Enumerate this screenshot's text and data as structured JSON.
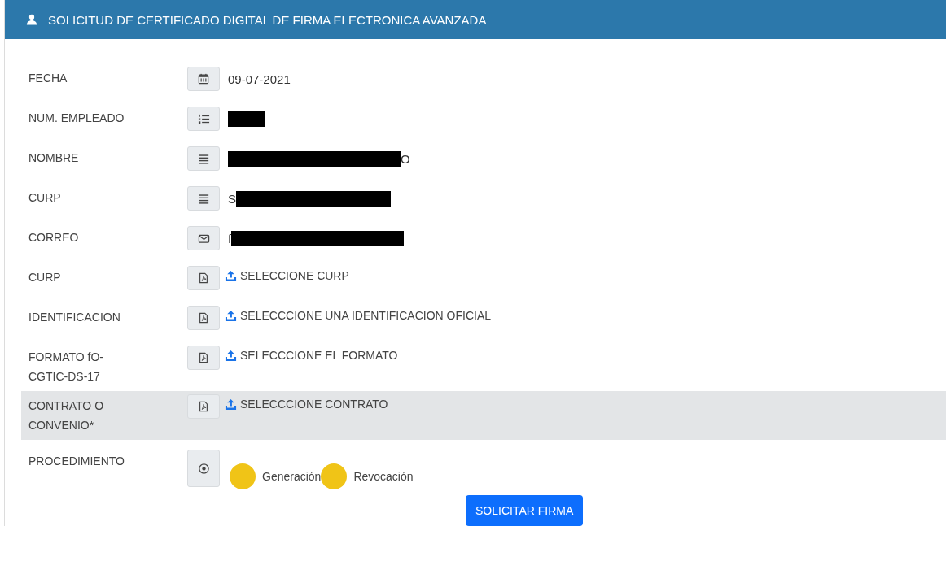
{
  "header": {
    "title": "SOLICITUD DE CERTIFICADO DIGITAL DE FIRMA ELECTRONICA AVANZADA"
  },
  "rows": [
    {
      "kind": "text",
      "label": "FECHA",
      "addon": {
        "kind": "calendar"
      },
      "highlighted": false,
      "parts": [
        {
          "kind": "text",
          "text": "09-07-2021"
        }
      ]
    },
    {
      "kind": "text",
      "label": "NUM. EMPLEADO",
      "addon": {
        "kind": "numbered"
      },
      "highlighted": false,
      "parts": [
        {
          "kind": "shortbar"
        }
      ]
    },
    {
      "kind": "text",
      "label": "NOMBRE",
      "addon": {
        "kind": "lines"
      },
      "highlighted": false,
      "parts": [
        {
          "kind": "longbar"
        },
        {
          "kind": "text",
          "text": "O"
        }
      ]
    },
    {
      "kind": "text",
      "label": "CURP",
      "addon": {
        "kind": "lines"
      },
      "highlighted": false,
      "parts": [
        {
          "kind": "text",
          "text": "S"
        },
        {
          "kind": "mediumbar"
        }
      ]
    },
    {
      "kind": "text",
      "label": "CORREO",
      "addon": {
        "kind": "envelope"
      },
      "highlighted": false,
      "parts": [
        {
          "kind": "text",
          "text": "f"
        },
        {
          "kind": "longbar"
        }
      ]
    },
    {
      "kind": "upload",
      "label": "CURP",
      "addon": {
        "kind": "pdf"
      },
      "highlighted": false,
      "link": "SELECCIONE CURP"
    },
    {
      "kind": "upload",
      "label": "IDENTIFICACION",
      "addon": {
        "kind": "pdf"
      },
      "highlighted": false,
      "link": "SELECCCIONE UNA IDENTIFICACION OFICIAL"
    },
    {
      "kind": "upload",
      "label": "FORMATO fO-CGTIC-DS-17",
      "addon": {
        "kind": "pdf"
      },
      "highlighted": false,
      "link": "SELECCCIONE EL FORMATO"
    },
    {
      "kind": "upload",
      "label": "CONTRATO O CONVENIO*",
      "addon": {
        "kind": "pdf"
      },
      "highlighted": true,
      "link": "SELECCCIONE CONTRATO"
    },
    {
      "kind": "radio",
      "label": "PROCEDIMIENTO",
      "addon": {
        "kind": "target"
      },
      "highlighted": false,
      "options": [
        {
          "label": "Generación",
          "selected": false
        },
        {
          "label": "Revocación",
          "selected": false
        }
      ]
    }
  ],
  "submit": {
    "label": "SOLICITAR FIRMA"
  }
}
